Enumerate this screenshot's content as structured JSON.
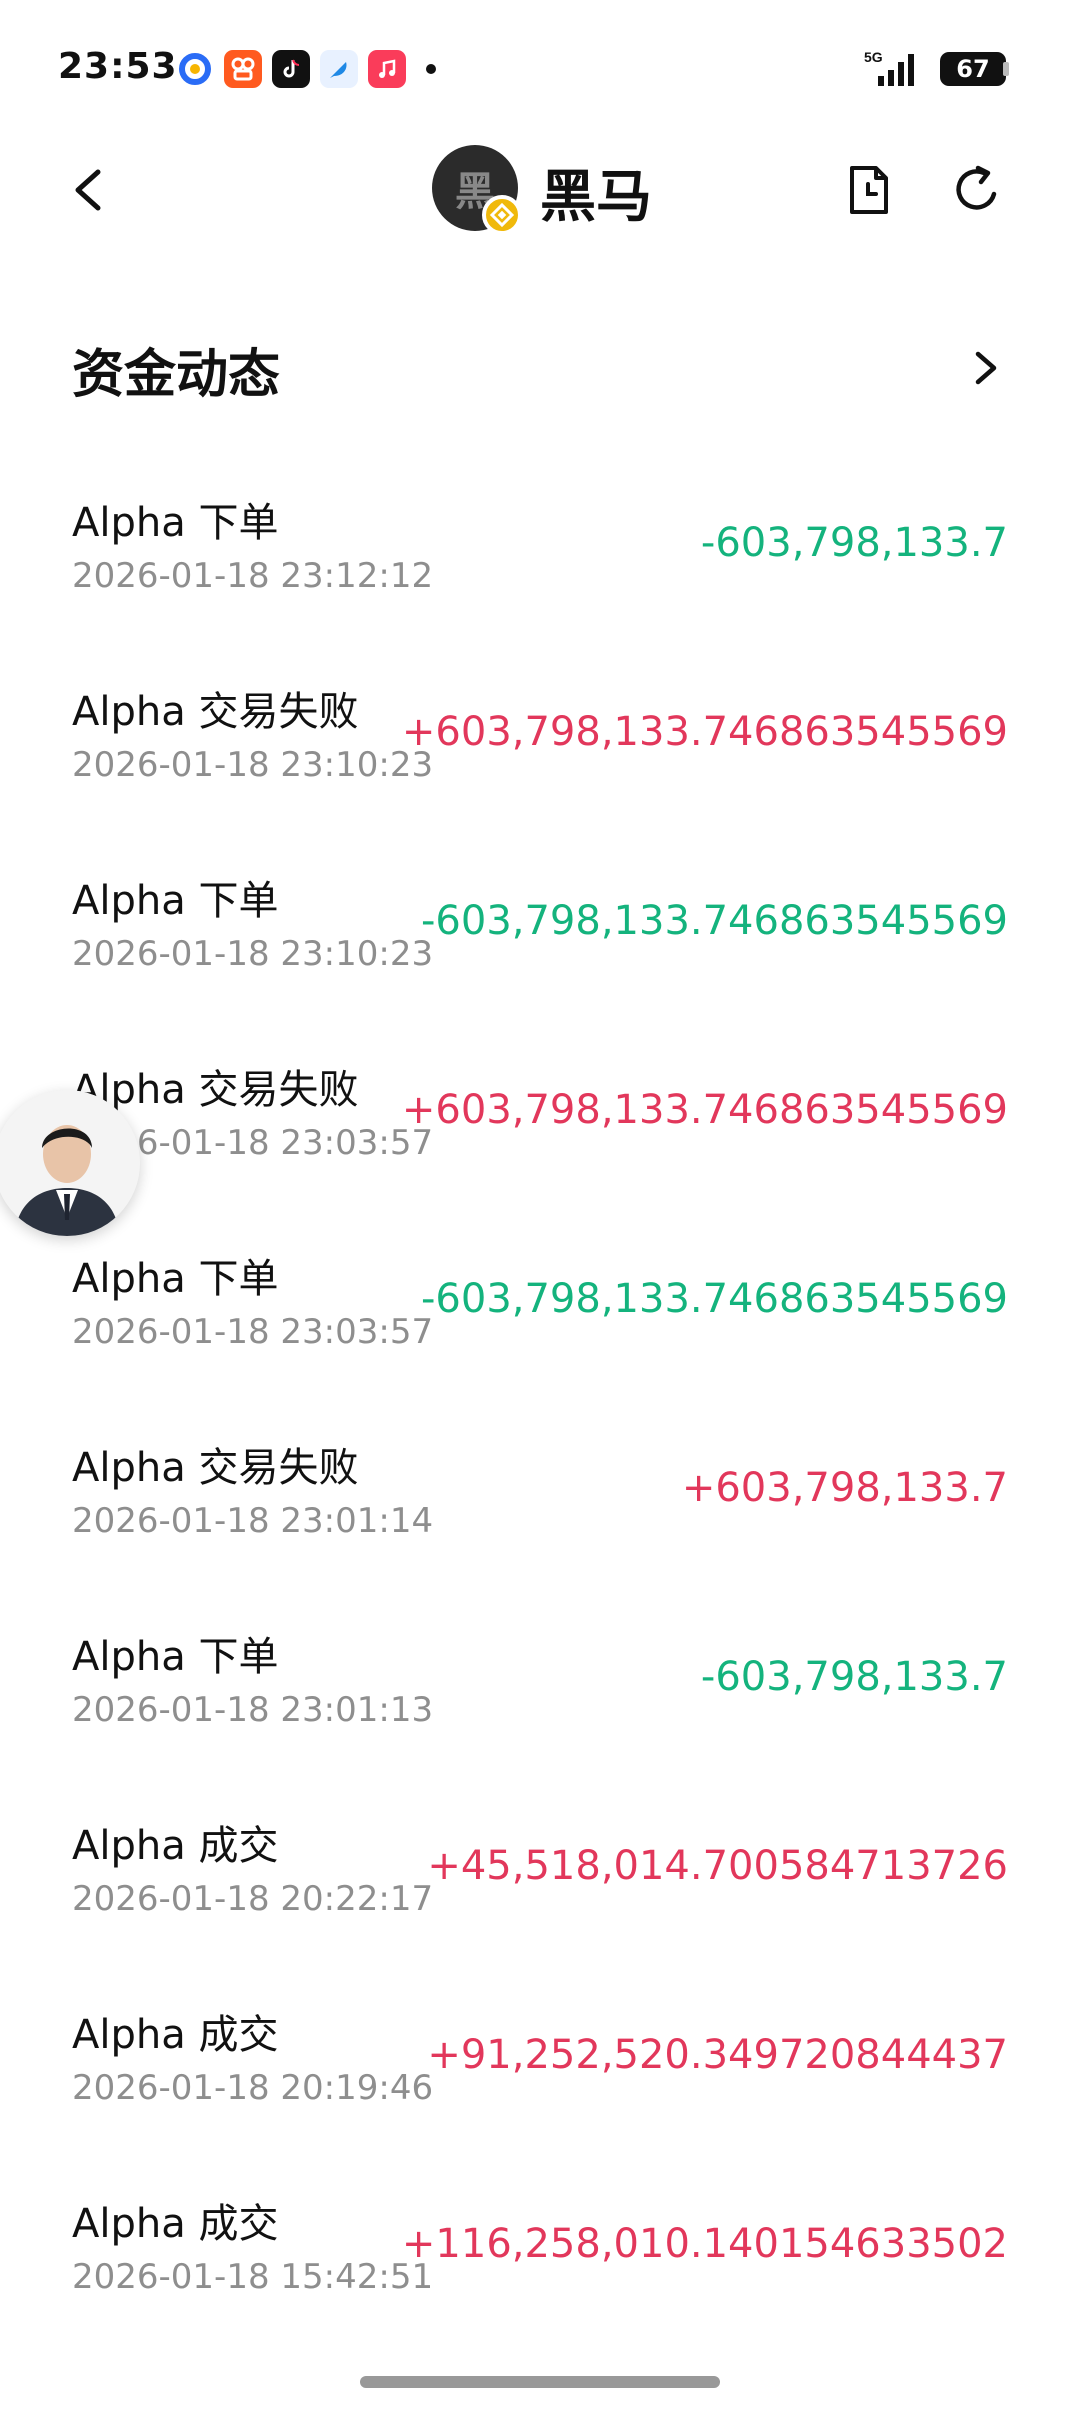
{
  "status_bar": {
    "time": "23:53",
    "network": "5G",
    "battery": "67",
    "icons": [
      "browser-icon",
      "kuaishou-icon",
      "tiktok-icon",
      "feather-icon",
      "music-icon"
    ]
  },
  "header": {
    "avatar_char": "黑",
    "title": "黑马"
  },
  "section": {
    "title": "资金动态"
  },
  "transactions": [
    {
      "title": "Alpha 下单",
      "time": "2026-01-18 23:12:12",
      "amount": "-603,798,133.7",
      "sign": "neg"
    },
    {
      "title": "Alpha 交易失败",
      "time": "2026-01-18 23:10:23",
      "amount": "+603,798,133.746863545569",
      "sign": "pos"
    },
    {
      "title": "Alpha 下单",
      "time": "2026-01-18 23:10:23",
      "amount": "-603,798,133.746863545569",
      "sign": "neg"
    },
    {
      "title": "Alpha 交易失败",
      "time": "2026-01-18 23:03:57",
      "amount": "+603,798,133.746863545569",
      "sign": "pos"
    },
    {
      "title": "Alpha 下单",
      "time": "2026-01-18 23:03:57",
      "amount": "-603,798,133.746863545569",
      "sign": "neg"
    },
    {
      "title": "Alpha 交易失败",
      "time": "2026-01-18 23:01:14",
      "amount": "+603,798,133.7",
      "sign": "pos"
    },
    {
      "title": "Alpha 下单",
      "time": "2026-01-18 23:01:13",
      "amount": "-603,798,133.7",
      "sign": "neg"
    },
    {
      "title": "Alpha 成交",
      "time": "2026-01-18 20:22:17",
      "amount": "+45,518,014.700584713726",
      "sign": "pos"
    },
    {
      "title": "Alpha 成交",
      "time": "2026-01-18 20:19:46",
      "amount": "+91,252,520.349720844437",
      "sign": "pos"
    },
    {
      "title": "Alpha 成交",
      "time": "2026-01-18 15:42:51",
      "amount": "+116,258,010.140154633502",
      "sign": "pos"
    }
  ],
  "colors": {
    "positive": "#e2375b",
    "negative": "#14b37d"
  }
}
